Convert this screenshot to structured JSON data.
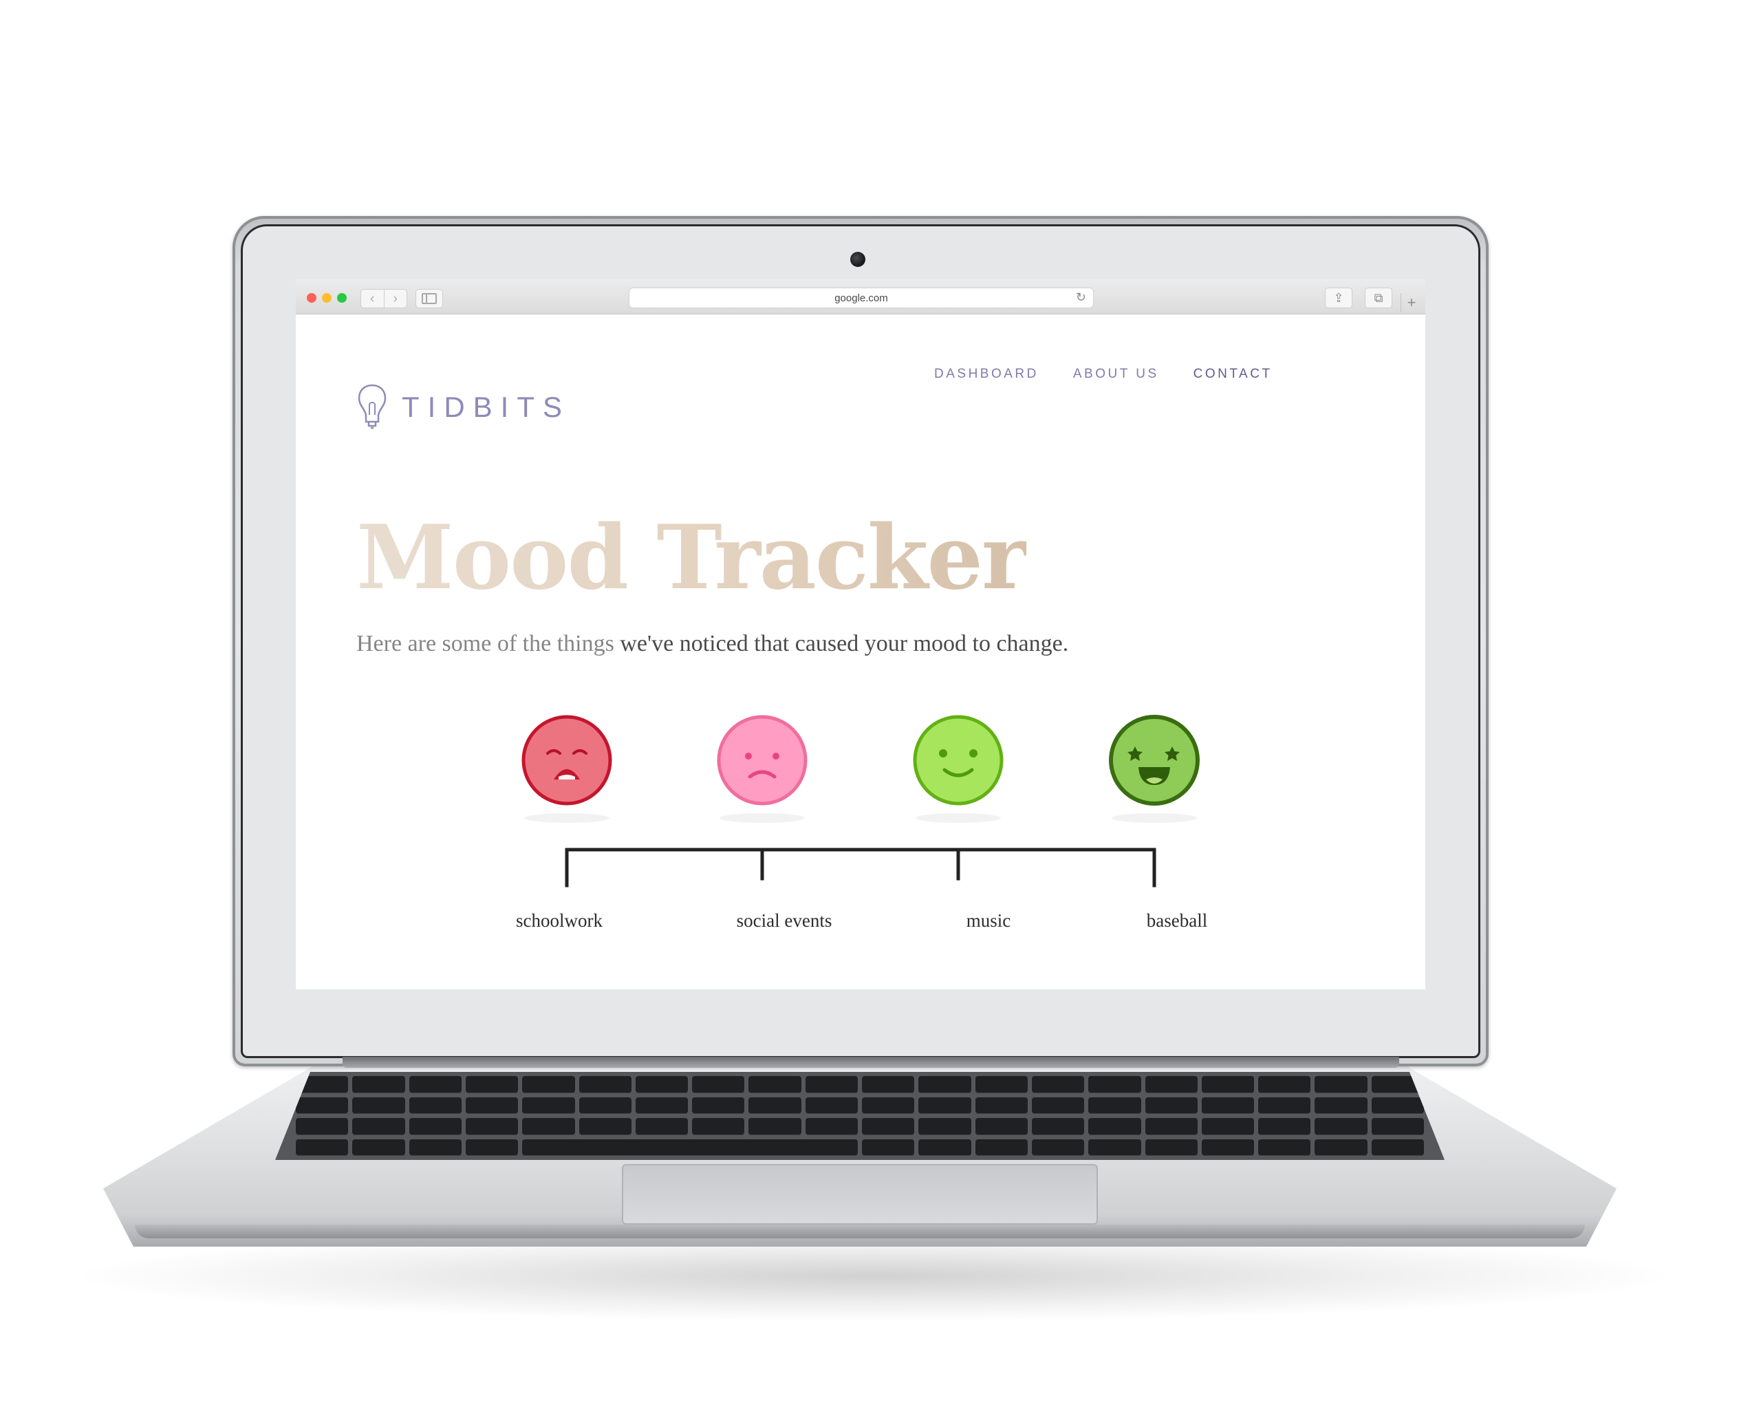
{
  "browser": {
    "url": "google.com",
    "reload_glyph": "↻",
    "back_glyph": "‹",
    "forward_glyph": "›",
    "share_glyph": "⇪",
    "tabs_glyph": "⧉",
    "newtab_glyph": "+"
  },
  "site": {
    "logo_text": "TIDBITS",
    "logo_icon": "lightbulb-icon",
    "nav": [
      {
        "label": "DASHBOARD"
      },
      {
        "label": "ABOUT US"
      },
      {
        "label": "CONTACT"
      }
    ]
  },
  "hero": {
    "title": "Mood Tracker",
    "subtitle_muted": "Here are some of the things ",
    "subtitle_main": "we've noticed that caused your mood to change."
  },
  "moods": [
    {
      "icon": "crying-face-icon",
      "label": "schoolwork",
      "fill": "#ec7480",
      "stroke": "#c4162e"
    },
    {
      "icon": "sad-face-icon",
      "label": "social events",
      "fill": "#ff9ec2",
      "stroke": "#f06e9c"
    },
    {
      "icon": "smiling-face-icon",
      "label": "music",
      "fill": "#a7e55c",
      "stroke": "#62b114"
    },
    {
      "icon": "star-eyed-face-icon",
      "label": "baseball",
      "fill": "#8fcb57",
      "stroke": "#3a6d10"
    }
  ]
}
